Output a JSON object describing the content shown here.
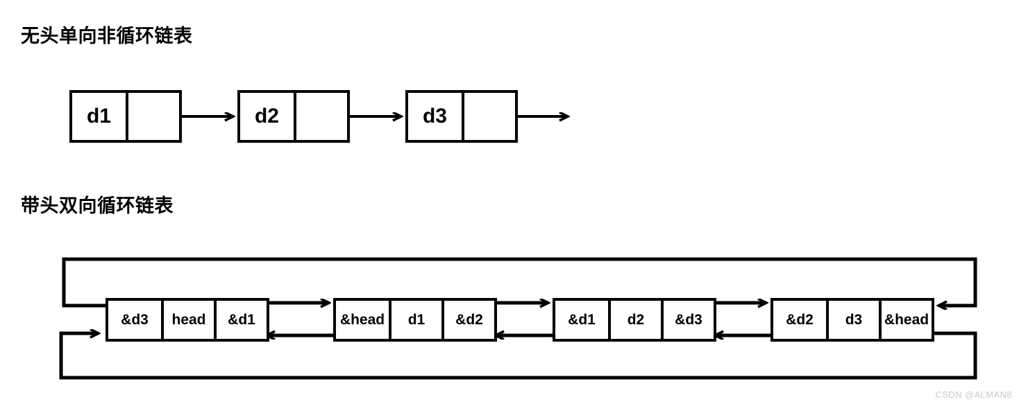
{
  "sections": [
    {
      "id": "singly",
      "title": "无头单向非循环链表",
      "nodes": [
        {
          "data": "d1",
          "pointer": ""
        },
        {
          "data": "d2",
          "pointer": ""
        },
        {
          "data": "d3",
          "pointer": ""
        }
      ],
      "trailing_arrow": true
    },
    {
      "id": "doubly",
      "title": "带头双向循环链表",
      "nodes": [
        {
          "prev": "&d3",
          "data": "head",
          "next": "&d1"
        },
        {
          "prev": "&head",
          "data": "d1",
          "next": "&d2"
        },
        {
          "prev": "&d1",
          "data": "d2",
          "next": "&d3"
        },
        {
          "prev": "&d2",
          "data": "d3",
          "next": "&head"
        }
      ],
      "wrap_arrows": {
        "top_label": "tail-next-to-head",
        "bottom_label": "head-prev-to-tail"
      }
    }
  ],
  "watermark": "CSDN @ALMAN8",
  "colors": {
    "stroke": "#000000",
    "background": "#ffffff",
    "watermark": "#c9c9c9"
  }
}
